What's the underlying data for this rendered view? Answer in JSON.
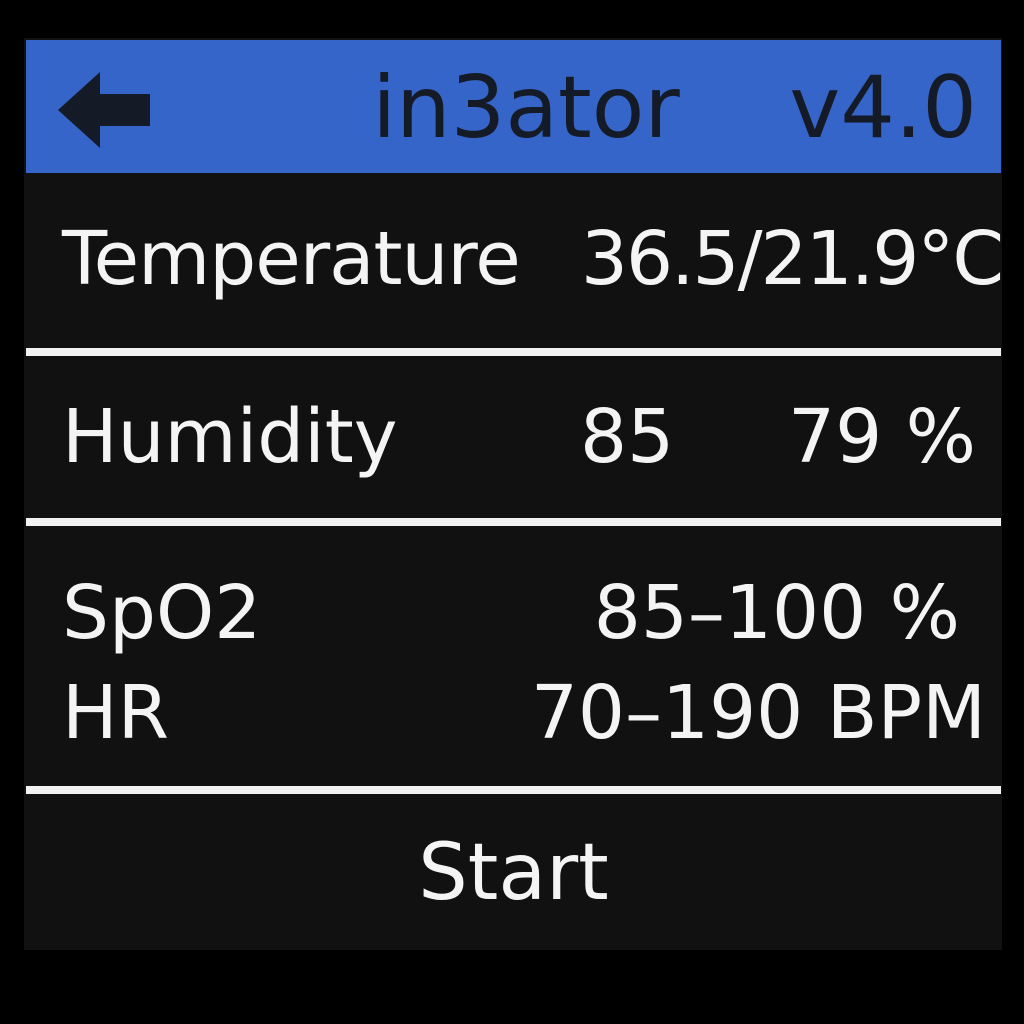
{
  "header": {
    "back_icon": "left-arrow-icon",
    "title": "in3ator",
    "version": "v4.0",
    "background_color": "#3565c8"
  },
  "rows": {
    "temperature": {
      "label": "Temperature",
      "value": "36.5/21.9°C"
    },
    "humidity": {
      "label": "Humidity",
      "value_set": "85",
      "value_current": "79 %"
    },
    "spo2": {
      "label": "SpO2",
      "value": "85–100 %"
    },
    "hr": {
      "label": "HR",
      "value": "70–190 BPM"
    }
  },
  "actions": {
    "start_label": "Start"
  },
  "colors": {
    "background": "#111111",
    "text": "#f4f4f4",
    "divider": "#f2f2f2"
  }
}
